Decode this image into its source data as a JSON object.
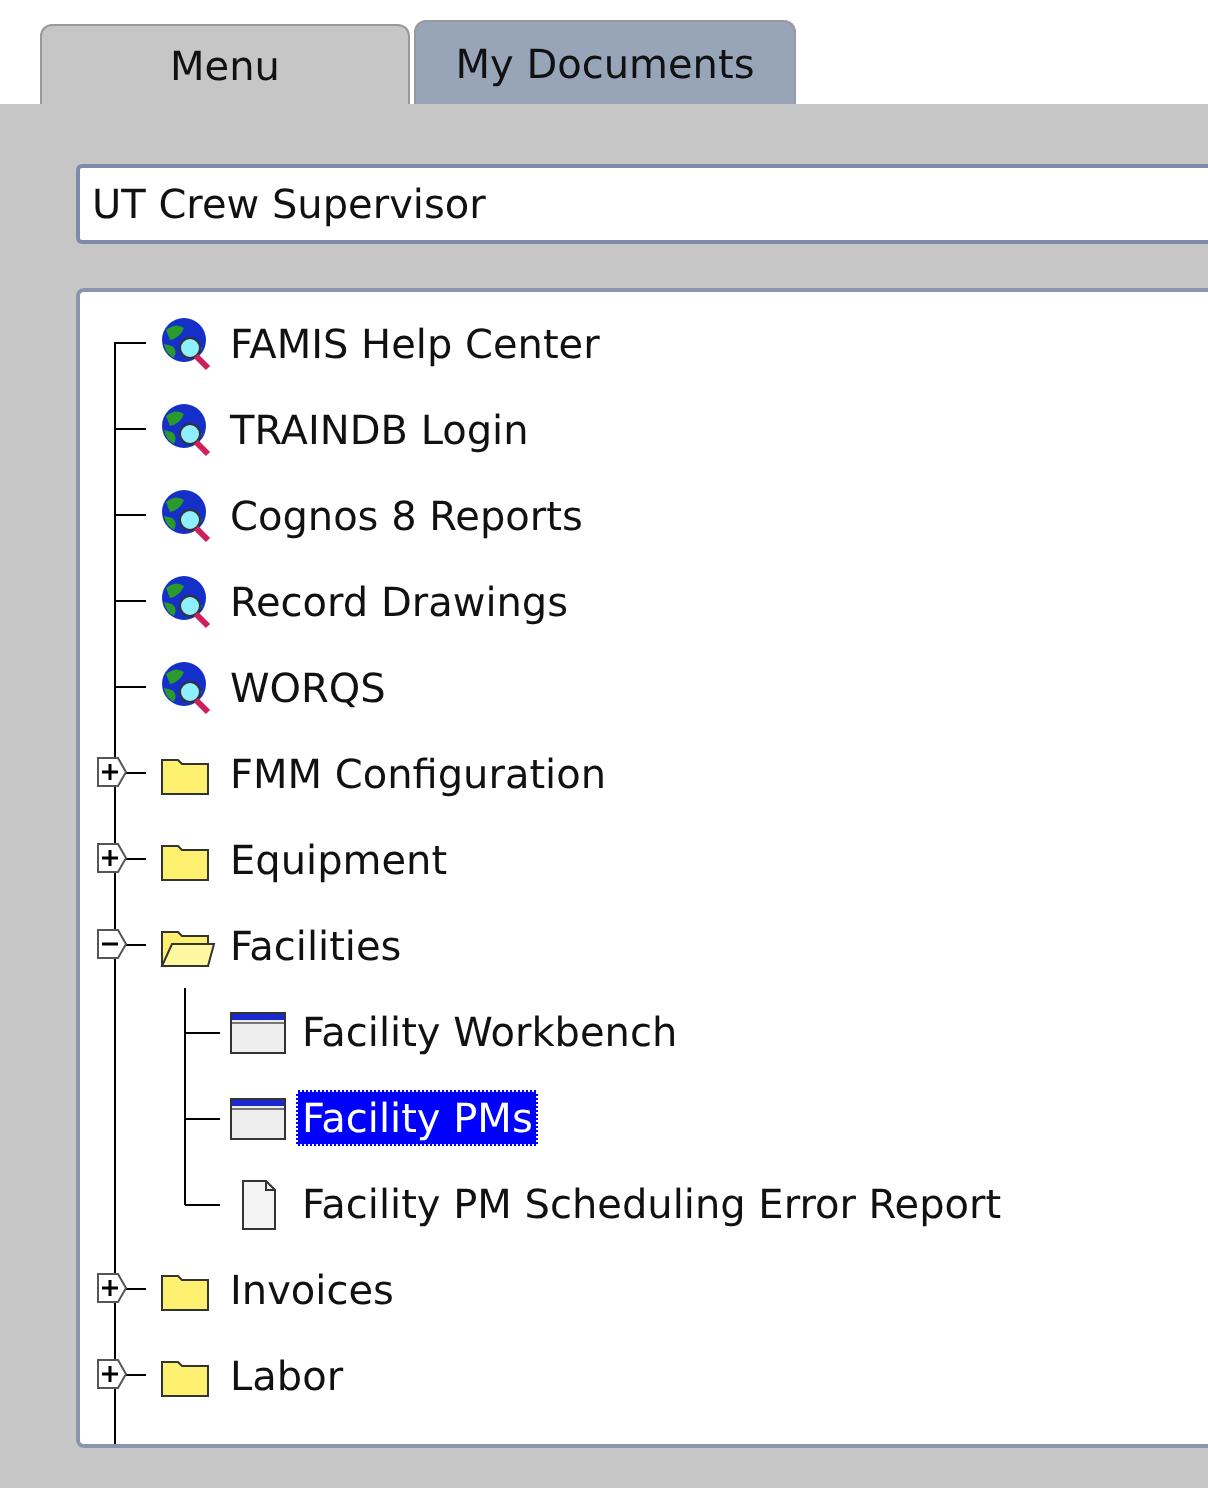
{
  "tabs": [
    {
      "label": "Menu",
      "selected": true
    },
    {
      "label": "My Documents",
      "selected": false
    }
  ],
  "responsibility": {
    "value": "UT Crew Supervisor"
  },
  "tree": [
    {
      "kind": "link",
      "label": "FAMIS Help Center",
      "selected": false
    },
    {
      "kind": "link",
      "label": "TRAINDB Login",
      "selected": false
    },
    {
      "kind": "link",
      "label": "Cognos 8 Reports",
      "selected": false
    },
    {
      "kind": "link",
      "label": "Record Drawings",
      "selected": false
    },
    {
      "kind": "link",
      "label": "WORQS",
      "selected": false
    },
    {
      "kind": "folder",
      "label": "FMM Configuration",
      "expanded": false,
      "selected": false
    },
    {
      "kind": "folder",
      "label": "Equipment",
      "expanded": false,
      "selected": false
    },
    {
      "kind": "folder",
      "label": "Facilities",
      "expanded": true,
      "selected": false,
      "children": [
        {
          "kind": "form",
          "label": "Facility Workbench",
          "selected": false
        },
        {
          "kind": "form",
          "label": "Facility PMs",
          "selected": true
        },
        {
          "kind": "report",
          "label": "Facility PM Scheduling Error Report",
          "selected": false
        }
      ]
    },
    {
      "kind": "folder",
      "label": "Invoices",
      "expanded": false,
      "selected": false
    },
    {
      "kind": "folder",
      "label": "Labor",
      "expanded": false,
      "selected": false
    }
  ]
}
